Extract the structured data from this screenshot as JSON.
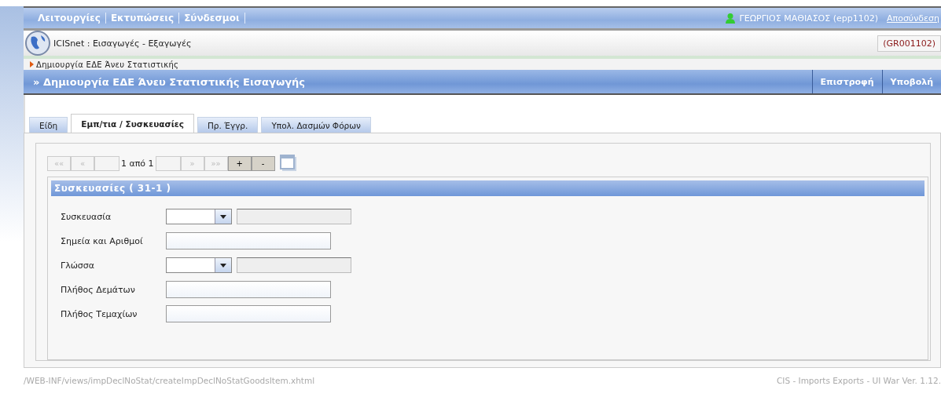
{
  "menu": [
    {
      "label": "Λειτουργίες"
    },
    {
      "label": "Εκτυπώσεις"
    },
    {
      "label": "Σύνδεσμοι"
    }
  ],
  "user": {
    "name": "ΓΕΩΡΓΙΟΣ ΜΑΘΙΑΣΟΣ (epp1102)",
    "logout": "Αποσύνδεση"
  },
  "header": {
    "app_title": "ICISnet : Εισαγωγές - Εξαγωγές",
    "code": "(GR001102)"
  },
  "breadcrumb": "Δημιουργία ΕΔΕ Άνευ Στατιστικής",
  "title_bar": {
    "title": "» Δημιουργία ΕΔΕ Άνευ Στατιστικής Εισαγωγής",
    "actions": [
      "Επιστροφή",
      "Υποβολή"
    ]
  },
  "tabs": [
    {
      "label": "Είδη",
      "selected": false
    },
    {
      "label": "Εμπ/τια / Συσκευασίες",
      "selected": true
    },
    {
      "label": "Πρ. Έγγρ.",
      "selected": false
    },
    {
      "label": "Υπολ. Δασμών Φόρων",
      "selected": false
    }
  ],
  "pager": {
    "buttons": [
      {
        "label": "««",
        "disabled": true
      },
      {
        "label": "«",
        "disabled": true
      }
    ],
    "page_text": "1 από 1",
    "next_buttons": [
      {
        "label": "»",
        "disabled": true
      },
      {
        "label": "»»",
        "disabled": true
      }
    ],
    "add": "+",
    "remove": "-"
  },
  "section": {
    "title": "Συσκευασίες ( 31-1 )",
    "fields": [
      {
        "label": "Συσκευασία",
        "kind": "select"
      },
      {
        "label": "Σημεία και Αριθμοί",
        "kind": "text"
      },
      {
        "label": "Γλώσσα",
        "kind": "select"
      },
      {
        "label": "Πλήθος Δεμάτων",
        "kind": "text"
      },
      {
        "label": "Πλήθος Τεμαχίων",
        "kind": "text"
      }
    ]
  },
  "footer": {
    "path": "/WEB-INF/views/impDeclNoStat/createImpDeclNoStatGoodsItem.xhtml",
    "version": "CIS - Imports Exports - UI War Ver. 1.12."
  }
}
